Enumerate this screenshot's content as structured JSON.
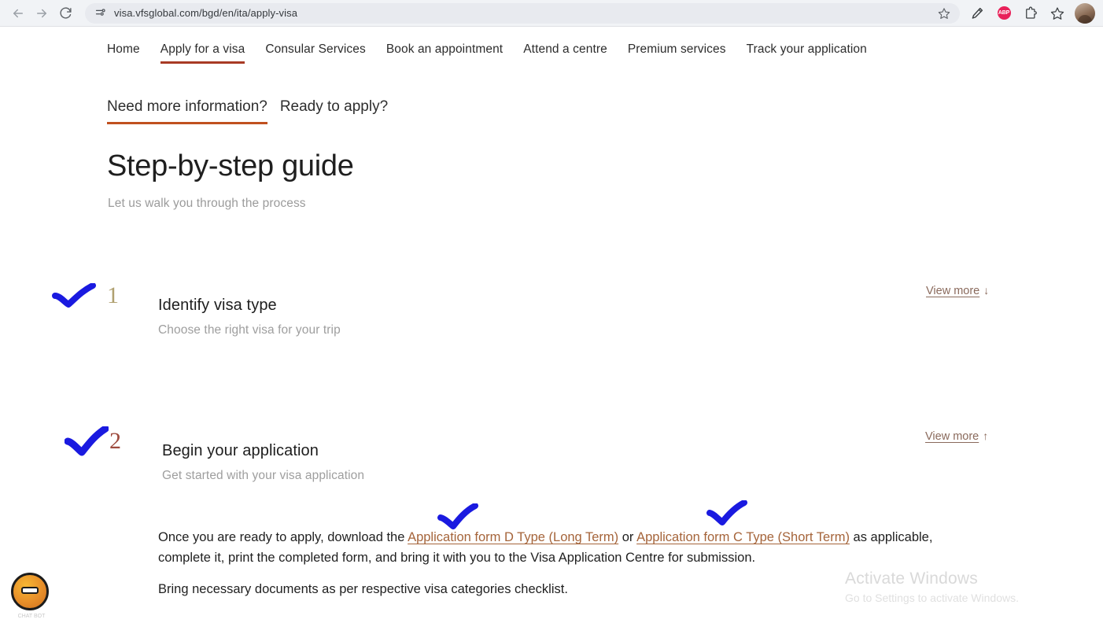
{
  "browser": {
    "back_label": "back-arrow",
    "forward_label": "forward-arrow",
    "reload_label": "reload",
    "url": "visa.vfsglobal.com/bgd/en/ita/apply-visa",
    "site_settings_icon": "tune-icon",
    "bookmark_icon": "star-icon",
    "toolbar_icons": [
      "pen-icon",
      "adblock-icon",
      "extensions-icon",
      "star-icon",
      "profile-avatar"
    ],
    "adblock_label": "ABP"
  },
  "nav": {
    "items": [
      {
        "label": "Home",
        "active": false
      },
      {
        "label": "Apply for a visa",
        "active": true
      },
      {
        "label": "Consular Services",
        "active": false
      },
      {
        "label": "Book an appointment",
        "active": false
      },
      {
        "label": "Attend a centre",
        "active": false
      },
      {
        "label": "Premium services",
        "active": false
      },
      {
        "label": "Track your application",
        "active": false
      }
    ]
  },
  "sub_tabs": [
    {
      "label": "Need more information?",
      "active": true
    },
    {
      "label": "Ready to apply?",
      "active": false
    }
  ],
  "header": {
    "title": "Step-by-step guide",
    "subtitle": "Let us walk you through the process"
  },
  "steps": [
    {
      "number": "1",
      "title": "Identify visa type",
      "description": "Choose the right visa for your trip",
      "view_more_label": "View more",
      "view_more_arrow": "↓",
      "number_color": "#b0a070"
    },
    {
      "number": "2",
      "title": "Begin your application",
      "description": "Get started with your visa application",
      "view_more_label": "View more",
      "view_more_arrow": "↑",
      "number_color": "#9e4b3e"
    }
  ],
  "step2_body": {
    "para1_before_link1": "Once you are ready to apply, download the ",
    "link1": "Application form D Type (Long Term)",
    "between_links": " or ",
    "link2": "Application form C Type (Short Term)",
    "para1_after_link2": " as applicable, complete it, print the completed form, and bring it with you to the Visa Application Centre for submission.",
    "para2": "Bring necessary documents as per respective visa categories checklist."
  },
  "chat_widget": {
    "icon": "chat-assistant-icon",
    "label": "CHAT BOT"
  },
  "watermark": {
    "title": "Activate Windows",
    "subtitle": "Go to Settings to activate Windows."
  },
  "colors": {
    "nav_accent": "#a83a25",
    "tab_accent": "#c0501f",
    "link": "#a5643a",
    "annotation": "#1a1ae0"
  }
}
